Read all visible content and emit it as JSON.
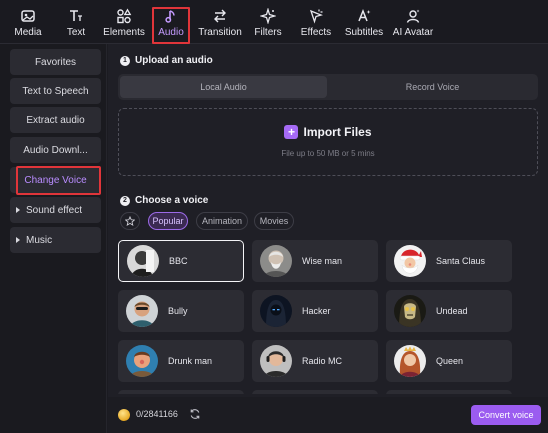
{
  "toolbar": {
    "items": [
      {
        "label": "Media",
        "icon": "media-icon"
      },
      {
        "label": "Text",
        "icon": "text-icon"
      },
      {
        "label": "Elements",
        "icon": "elements-icon"
      },
      {
        "label": "Audio",
        "icon": "music-note-icon",
        "active": true
      },
      {
        "label": "Transition",
        "icon": "transition-icon"
      },
      {
        "label": "Filters",
        "icon": "sparkle-icon"
      },
      {
        "label": "Effects",
        "icon": "effects-icon"
      },
      {
        "label": "Subtitles",
        "icon": "subtitles-icon"
      },
      {
        "label": "AI Avatar",
        "icon": "avatar-icon"
      }
    ]
  },
  "sidebar": {
    "items": [
      {
        "label": "Favorites"
      },
      {
        "label": "Text to Speech"
      },
      {
        "label": "Extract audio"
      },
      {
        "label": "Audio Downl..."
      },
      {
        "label": "Change Voice",
        "active": true
      },
      {
        "label": "Sound effect",
        "expandable": true
      },
      {
        "label": "Music",
        "expandable": true
      }
    ]
  },
  "upload": {
    "step": "1",
    "title": "Upload an audio",
    "tabs": [
      "Local Audio",
      "Record Voice"
    ],
    "active_tab": "Local Audio",
    "import_label": "Import Files",
    "hint": "File up to 50 MB or 5 mins"
  },
  "voice": {
    "step": "2",
    "title": "Choose a voice",
    "filters": [
      "Popular",
      "Animation",
      "Movies"
    ],
    "active_filter": "Popular",
    "voices": [
      {
        "name": "BBC",
        "selected": true
      },
      {
        "name": "Wise man"
      },
      {
        "name": "Santa Claus"
      },
      {
        "name": "Bully"
      },
      {
        "name": "Hacker"
      },
      {
        "name": "Undead"
      },
      {
        "name": "Drunk man"
      },
      {
        "name": "Radio MC"
      },
      {
        "name": "Queen"
      }
    ]
  },
  "footer": {
    "credits": "0/2841166",
    "convert_label": "Convert voice"
  },
  "colors": {
    "accent": "#9b5cf0",
    "highlight_box": "#e0353a"
  }
}
